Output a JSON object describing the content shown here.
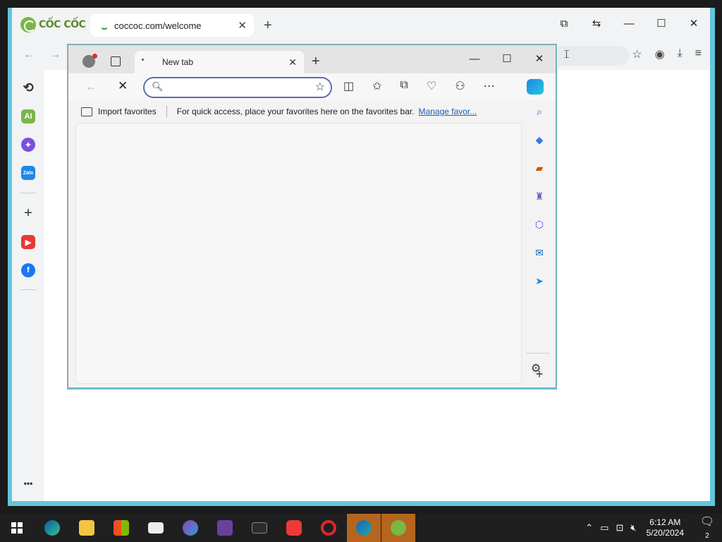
{
  "coccoc": {
    "logo_text": "CỐC CỐC",
    "tab": {
      "title": "coccoc.com/welcome",
      "close": "✕"
    },
    "new_tab": "+",
    "window_buttons": {
      "minimize": "—",
      "maximize": "☐",
      "close": "✕"
    },
    "sidebar": [
      {
        "name": "history",
        "label": ""
      },
      {
        "name": "ai",
        "label": "AI"
      },
      {
        "name": "messenger",
        "label": ""
      },
      {
        "name": "zalo",
        "label": "Zalo"
      },
      {
        "name": "add",
        "label": "+"
      },
      {
        "name": "youtube",
        "label": ""
      },
      {
        "name": "facebook",
        "label": ""
      },
      {
        "name": "more",
        "label": "•••"
      }
    ],
    "colors": {
      "brand": "#7ab648",
      "frame": "#62c6dc"
    }
  },
  "edge": {
    "tab": {
      "title": "New tab",
      "close": "✕"
    },
    "new_tab": "+",
    "window_buttons": {
      "minimize": "—",
      "maximize": "☐",
      "close": "✕"
    },
    "address": {
      "value": "",
      "placeholder": ""
    },
    "favorites_bar": {
      "import": "Import favorites",
      "hint": "For quick access, place your favorites here on the favorites bar.",
      "manage": "Manage favor..."
    },
    "sidebar_add": "+"
  },
  "taskbar": {
    "apps": [
      "start",
      "edge",
      "file-explorer",
      "store",
      "mail",
      "firefox",
      "brave",
      "terminal",
      "vivaldi",
      "opera",
      "edge-canary",
      "coccoc"
    ],
    "clock": {
      "time": "6:12 AM",
      "date": "5/20/2024"
    },
    "notification_count": "2"
  }
}
